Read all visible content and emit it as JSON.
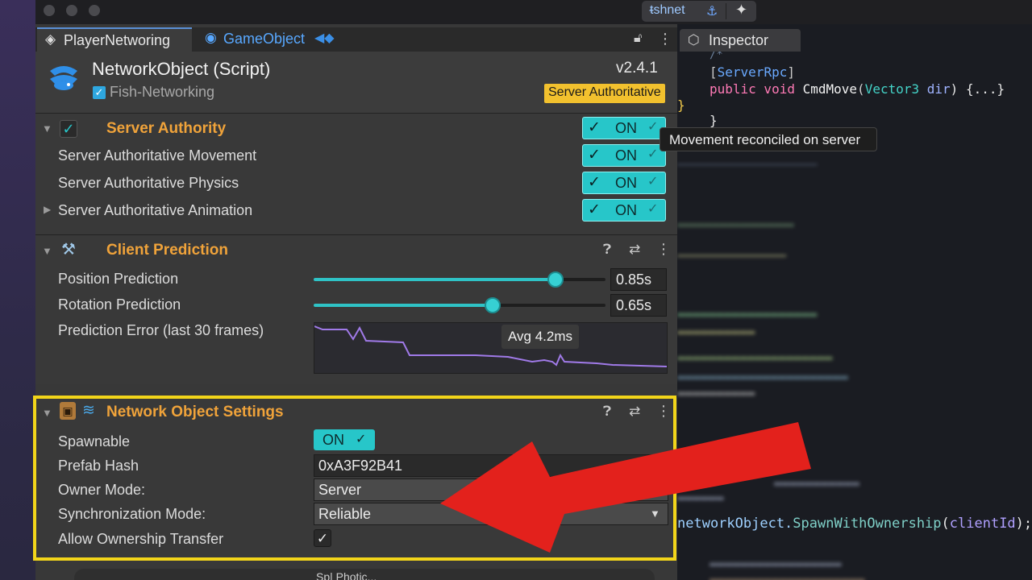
{
  "window": {
    "tool_label": "FishNet",
    "tool_label_display": "ᵵshnet"
  },
  "tabs": [
    {
      "label": "PlayerNetworing",
      "icon": "layers-icon"
    },
    {
      "label": "GameObject",
      "icon": "cube-icon"
    }
  ],
  "inspector_tab": {
    "label": "Inspector",
    "icon": "cube-outline-icon"
  },
  "component": {
    "title": "NetworkObject (Script)",
    "subtitle": "Fish-Networking",
    "version": "v2.4.1",
    "badge": "Server Authoritative",
    "badge_color": "#f2c12e"
  },
  "server_authority": {
    "title": "Server Authority",
    "toggle_label": "ON",
    "rows": [
      {
        "label": "Server Authoritative Movement",
        "toggle": "ON"
      },
      {
        "label": "Server Authoritative Physics",
        "toggle": "ON"
      },
      {
        "label": "Server Authoritative Animation",
        "toggle": "ON"
      }
    ],
    "tooltip": "Movement reconciled on server"
  },
  "client_prediction": {
    "title": "Client Prediction",
    "position": {
      "label": "Position Prediction",
      "value": "0.85s",
      "fraction": 0.85
    },
    "rotation": {
      "label": "Rotation Prediction",
      "value": "0.65s",
      "fraction": 0.65
    },
    "error": {
      "label": "Prediction Error (last 30 frames)",
      "avg": "Avg 4.2ms"
    }
  },
  "network_settings": {
    "title": "Network Object Settings",
    "spawnable": {
      "label": "Spawnable",
      "value": "ON"
    },
    "prefab_hash": {
      "label": "Prefab Hash",
      "value": "0xA3F92B41"
    },
    "owner_mode": {
      "label": "Owner Mode:",
      "value": "Server"
    },
    "sync_mode": {
      "label": "Synchronization Mode:",
      "value": "Reliable"
    },
    "ownership_transfer": {
      "label": "Allow Ownership Transfer",
      "checked": true
    }
  },
  "footer": {
    "label": "Sp| Photic..."
  },
  "code": {
    "comment": "/*",
    "attr": "[ServerRpc]",
    "sig_kw": "public void",
    "sig_fn": "CmdMove",
    "sig_type": "Vector3",
    "sig_arg": "dir",
    "sig_tail": ") {...}",
    "brace1": "}",
    "brace2": "}",
    "spawn_obj": "networkObject.",
    "spawn_fn": "SpawnWithOwnership",
    "spawn_arg": "clientId",
    "spawn_tail": ");"
  },
  "colors": {
    "accent": "#27c6c9",
    "section_title": "#f0a33a",
    "highlight": "#f2d51a",
    "arrow": "#e3211c"
  }
}
